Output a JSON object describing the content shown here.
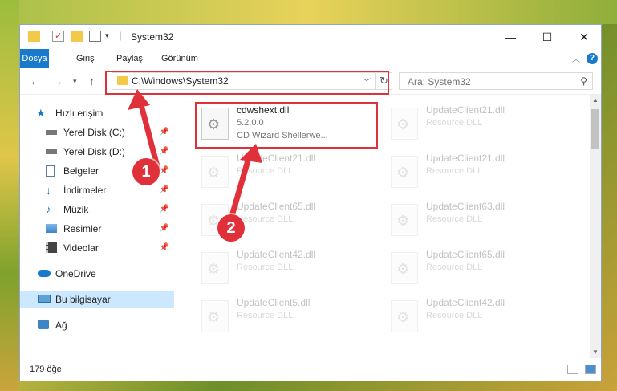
{
  "title": "System32",
  "ribbon": {
    "tabs": [
      "Dosya",
      "Giriş",
      "Paylaş",
      "Görünüm"
    ]
  },
  "address": {
    "path": "C:\\Windows\\System32"
  },
  "search": {
    "placeholder": "Ara: System32"
  },
  "sidebar": {
    "items": [
      {
        "label": "Hızlı erişim",
        "icon": "star-icon"
      },
      {
        "label": "Yerel Disk (C:)",
        "icon": "drive-icon"
      },
      {
        "label": "Yerel Disk (D:)",
        "icon": "drive-icon"
      },
      {
        "label": "Belgeler",
        "icon": "documents-icon"
      },
      {
        "label": "İndirmeler",
        "icon": "download-icon"
      },
      {
        "label": "Müzik",
        "icon": "music-icon"
      },
      {
        "label": "Resimler",
        "icon": "pictures-icon"
      },
      {
        "label": "Videolar",
        "icon": "videos-icon"
      },
      {
        "label": "OneDrive",
        "icon": "cloud-icon"
      },
      {
        "label": "Bu bilgisayar",
        "icon": "computer-icon"
      },
      {
        "label": "Ağ",
        "icon": "network-icon"
      }
    ]
  },
  "files": {
    "highlighted": {
      "name": "cdwshext.dll",
      "version": "5.2.0.0",
      "desc": "CD Wizard Shellerwe..."
    },
    "items": [
      {
        "name": "UpdateClient21.dll",
        "type": "Resource DLL"
      },
      {
        "name": "UpdateClient21.dll",
        "type": "Resource DLL"
      },
      {
        "name": "UpdateClient21.dll",
        "type": "Resource DLL"
      },
      {
        "name": "UpdateClient65.dll",
        "type": "Resource DLL"
      },
      {
        "name": "UpdateClient63.dll",
        "type": "Resource DLL"
      },
      {
        "name": "UpdateClient42.dll",
        "type": "Resource DLL"
      },
      {
        "name": "UpdateClient65.dll",
        "type": "Resource DLL"
      },
      {
        "name": "UpdateClient5.dll",
        "type": "Resource DLL"
      },
      {
        "name": "UpdateClient42.dll",
        "type": "Resource DLL"
      }
    ]
  },
  "status": {
    "count": "179 öğe"
  },
  "annotations": {
    "badge1": "1",
    "badge2": "2"
  },
  "colors": {
    "accent": "#1979ca",
    "highlight": "#e0303a",
    "selected": "#cce8ff"
  }
}
